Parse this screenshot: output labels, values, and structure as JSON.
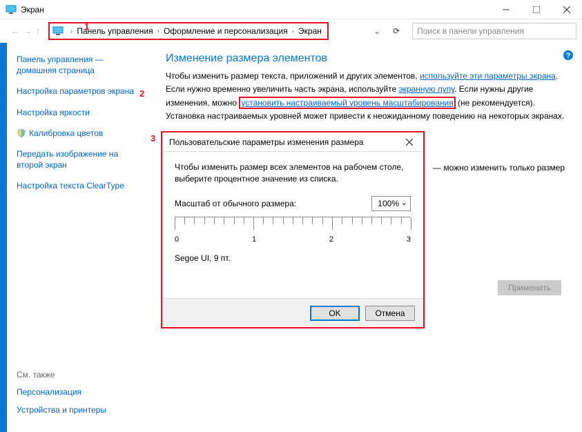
{
  "titlebar": {
    "title": "Экран"
  },
  "breadcrumb": {
    "items": [
      "Панель управления",
      "Оформление и персонализация",
      "Экран"
    ]
  },
  "search": {
    "placeholder": "Поиск в панели управления"
  },
  "sidebar": {
    "home": "Панель управления — домашняя страница",
    "items": [
      "Настройка параметров экрана",
      "Настройка яркости",
      "Калибровка цветов",
      "Передать изображение на второй экран",
      "Настройка текста ClearType"
    ],
    "see_also_title": "См. также",
    "see_also": [
      "Персонализация",
      "Устройства и принтеры"
    ]
  },
  "content": {
    "heading": "Изменение размера элементов",
    "p1_a": "Чтобы изменить размер текста, приложений и других элементов, ",
    "p1_link": "используйте эти параметры экрана",
    "p1_b": ".",
    "p2_a": "Если нужно временно увеличить часть экрана, используйте ",
    "p2_link1": "экранную лупу",
    "p2_b": ". Если нужны другие",
    "p3_a": "изменения, можно ",
    "p3_link": "установить настраиваемый уровень масштабирования",
    "p3_b": " (не рекомендуется).",
    "p4": "Установка настраиваемых уровней может привести к неожиданному поведению на некоторых экранах.",
    "extra": "— можно изменить только размер",
    "apply": "Применить"
  },
  "dialog": {
    "title": "Пользовательские параметры изменения размера",
    "intro": "Чтобы изменить размер всех элементов на рабочем столе, выберите процентное значение из списка.",
    "scale_label": "Масштаб от обычного размера:",
    "scale_value": "100%",
    "ruler_labels": [
      "0",
      "1",
      "2",
      "3"
    ],
    "font_sample": "Segoe UI, 9 пт.",
    "ok": "OK",
    "cancel": "Отмена"
  },
  "annotations": {
    "n1": "1",
    "n2": "2",
    "n3": "3"
  }
}
